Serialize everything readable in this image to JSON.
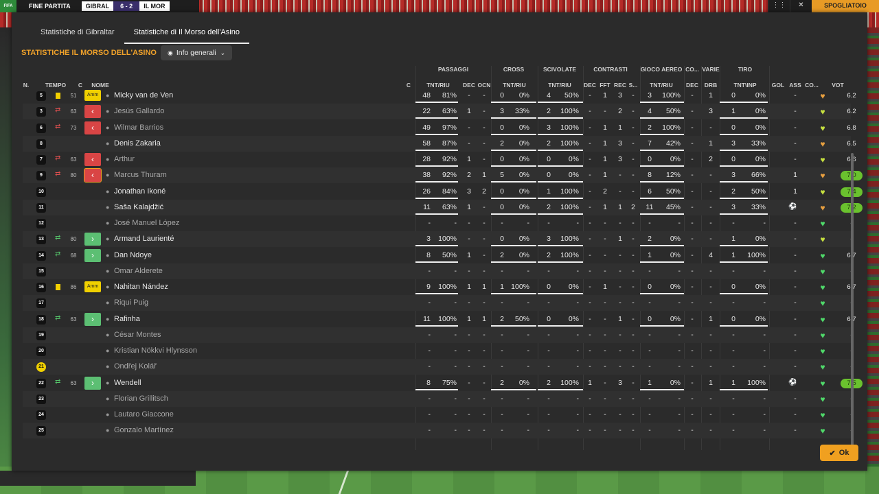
{
  "topbar": {
    "fp": "FINE PARTITA",
    "team1": "GIBRAL",
    "score": "6 - 2",
    "team2": "IL MOR",
    "skip": "SPOGLIATOIO",
    "ctrl1": "⋮⋮",
    "ctrl2": "✕",
    "logo": "FIFA"
  },
  "tabs": [
    {
      "label": "Statistiche di Gibraltar",
      "active": false
    },
    {
      "label": "Statistiche di Il Morso dell'Asino",
      "active": true
    }
  ],
  "title": "STATISTICHE IL MORSO DELL'ASINO",
  "dropdown": {
    "label": "Info generali"
  },
  "groups": {
    "passaggi": "PASSAGGI",
    "cross": "CROSS",
    "scivolate": "SCIVOLATE",
    "contrasti": "CONTRASTI",
    "aereo": "GIOCO AEREO",
    "co": "CO...",
    "varie": "VARIE",
    "tiro": "TIRO"
  },
  "cols": {
    "n": "N.",
    "tempo": "TEMPO",
    "c": "C",
    "nome": "NOME",
    "c2": "C",
    "tntriu1": "TNT/RIU",
    "dec1": "DEC",
    "ocn": "OCN",
    "tntriu2": "TNT/RIU",
    "tntriu3": "TNT/RIU",
    "dec2": "DEC",
    "fft": "FFT",
    "rec": "REC",
    "s": "S...",
    "tntriu4": "TNT/RIU",
    "dec3": "DEC",
    "drb": "DRB",
    "tntinp": "TNT\\INP",
    "gol": "GOL",
    "ass": "ASS",
    "co2": "CO...",
    "vot": "VOT"
  },
  "players": [
    {
      "n": "5",
      "card": "yellow",
      "min": "51",
      "badge": "Amm",
      "name": "Micky van de Ven",
      "dim": false,
      "pt": "48",
      "pr": "81%",
      "pd": "-",
      "po": "-",
      "ct": "0",
      "cr": "0%",
      "st": "4",
      "sr": "50%",
      "td": "-",
      "tf": "1",
      "trc": "3",
      "ts": "-",
      "at": "3",
      "ar": "100%",
      "cd": "-",
      "dr": "1",
      "tt": "0",
      "tr": "0%",
      "gol": "",
      "ass": "-",
      "heart": "orange",
      "vot": "6.2",
      "hi": false
    },
    {
      "n": "3",
      "card": "out",
      "min": "63",
      "badge": "out",
      "name": "Jesús Gallardo",
      "dim": true,
      "pt": "22",
      "pr": "63%",
      "pd": "1",
      "po": "-",
      "ct": "3",
      "cr": "33%",
      "st": "2",
      "sr": "100%",
      "td": "-",
      "tf": "-",
      "trc": "2",
      "ts": "-",
      "at": "4",
      "ar": "50%",
      "cd": "-",
      "dr": "3",
      "tt": "1",
      "tr": "0%",
      "gol": "",
      "ass": "-",
      "heart": "yellowgreen",
      "vot": "6.2",
      "hi": false
    },
    {
      "n": "6",
      "card": "out",
      "min": "73",
      "badge": "out",
      "name": "Wilmar Barrios",
      "dim": true,
      "pt": "49",
      "pr": "97%",
      "pd": "-",
      "po": "-",
      "ct": "0",
      "cr": "0%",
      "st": "3",
      "sr": "100%",
      "td": "-",
      "tf": "1",
      "trc": "1",
      "ts": "-",
      "at": "2",
      "ar": "100%",
      "cd": "-",
      "dr": "-",
      "tt": "0",
      "tr": "0%",
      "gol": "",
      "ass": "-",
      "heart": "yellowgreen",
      "vot": "6.8",
      "hi": false
    },
    {
      "n": "8",
      "card": "",
      "min": "",
      "badge": "",
      "name": "Denis Zakaria",
      "dim": false,
      "pt": "58",
      "pr": "87%",
      "pd": "-",
      "po": "-",
      "ct": "2",
      "cr": "0%",
      "st": "2",
      "sr": "100%",
      "td": "-",
      "tf": "1",
      "trc": "3",
      "ts": "-",
      "at": "7",
      "ar": "42%",
      "cd": "-",
      "dr": "1",
      "tt": "3",
      "tr": "33%",
      "gol": "",
      "ass": "-",
      "heart": "orange",
      "vot": "6.5",
      "hi": false
    },
    {
      "n": "7",
      "card": "out",
      "min": "63",
      "badge": "out",
      "name": "Arthur",
      "dim": true,
      "pt": "28",
      "pr": "92%",
      "pd": "1",
      "po": "-",
      "ct": "0",
      "cr": "0%",
      "st": "0",
      "sr": "0%",
      "td": "-",
      "tf": "1",
      "trc": "3",
      "ts": "-",
      "at": "0",
      "ar": "0%",
      "cd": "-",
      "dr": "2",
      "tt": "0",
      "tr": "0%",
      "gol": "",
      "ass": "-",
      "heart": "yellowgreen",
      "vot": "6.6",
      "hi": false
    },
    {
      "n": "9",
      "card": "out",
      "min": "80",
      "badge": "outsel",
      "name": "Marcus Thuram",
      "dim": true,
      "pt": "38",
      "pr": "92%",
      "pd": "2",
      "po": "1",
      "ct": "5",
      "cr": "0%",
      "st": "0",
      "sr": "0%",
      "td": "-",
      "tf": "1",
      "trc": "-",
      "ts": "-",
      "at": "8",
      "ar": "12%",
      "cd": "-",
      "dr": "-",
      "tt": "3",
      "tr": "66%",
      "gol": "",
      "ass": "1",
      "heart": "orange",
      "vot": "7.0",
      "hi": true
    },
    {
      "n": "10",
      "card": "",
      "min": "",
      "badge": "",
      "name": "Jonathan Ikoné",
      "dim": false,
      "pt": "26",
      "pr": "84%",
      "pd": "3",
      "po": "2",
      "ct": "0",
      "cr": "0%",
      "st": "1",
      "sr": "100%",
      "td": "-",
      "tf": "2",
      "trc": "-",
      "ts": "-",
      "at": "6",
      "ar": "50%",
      "cd": "-",
      "dr": "-",
      "tt": "2",
      "tr": "50%",
      "gol": "",
      "ass": "1",
      "heart": "yellowgreen",
      "vot": "7.4",
      "hi": true
    },
    {
      "n": "11",
      "card": "",
      "min": "",
      "badge": "",
      "name": "Saša Kalajdžić",
      "dim": false,
      "pt": "11",
      "pr": "63%",
      "pd": "1",
      "po": "-",
      "ct": "0",
      "cr": "0%",
      "st": "2",
      "sr": "100%",
      "td": "-",
      "tf": "1",
      "trc": "1",
      "ts": "2",
      "at": "11",
      "ar": "45%",
      "cd": "-",
      "dr": "-",
      "tt": "3",
      "tr": "33%",
      "gol": "ball",
      "ass": "-",
      "heart": "orange",
      "vot": "7.2",
      "hi": true
    },
    {
      "n": "12",
      "card": "",
      "min": "",
      "badge": "",
      "name": "José Manuel López",
      "dim": true,
      "pt": "-",
      "pr": "-",
      "pd": "-",
      "po": "-",
      "ct": "-",
      "cr": "-",
      "st": "-",
      "sr": "-",
      "td": "-",
      "tf": "-",
      "trc": "-",
      "ts": "-",
      "at": "-",
      "ar": "-",
      "cd": "-",
      "dr": "-",
      "tt": "-",
      "tr": "-",
      "gol": "",
      "ass": "-",
      "heart": "green",
      "vot": "-",
      "hi": false
    },
    {
      "n": "13",
      "card": "in",
      "min": "80",
      "badge": "in",
      "name": "Armand Laurienté",
      "dim": false,
      "pt": "3",
      "pr": "100%",
      "pd": "-",
      "po": "-",
      "ct": "0",
      "cr": "0%",
      "st": "3",
      "sr": "100%",
      "td": "-",
      "tf": "-",
      "trc": "1",
      "ts": "-",
      "at": "2",
      "ar": "0%",
      "cd": "-",
      "dr": "-",
      "tt": "1",
      "tr": "0%",
      "gol": "",
      "ass": "-",
      "heart": "yellowgreen",
      "vot": "-",
      "hi": false
    },
    {
      "n": "14",
      "card": "in",
      "min": "68",
      "badge": "in",
      "name": "Dan Ndoye",
      "dim": false,
      "pt": "8",
      "pr": "50%",
      "pd": "1",
      "po": "-",
      "ct": "2",
      "cr": "0%",
      "st": "2",
      "sr": "100%",
      "td": "-",
      "tf": "-",
      "trc": "-",
      "ts": "-",
      "at": "1",
      "ar": "0%",
      "cd": "-",
      "dr": "4",
      "tt": "1",
      "tr": "100%",
      "gol": "",
      "ass": "-",
      "heart": "green",
      "vot": "6.7",
      "hi": false
    },
    {
      "n": "15",
      "card": "",
      "min": "",
      "badge": "",
      "name": "Omar Alderete",
      "dim": true,
      "pt": "-",
      "pr": "-",
      "pd": "-",
      "po": "-",
      "ct": "-",
      "cr": "-",
      "st": "-",
      "sr": "-",
      "td": "-",
      "tf": "-",
      "trc": "-",
      "ts": "-",
      "at": "-",
      "ar": "-",
      "cd": "-",
      "dr": "-",
      "tt": "-",
      "tr": "-",
      "gol": "",
      "ass": "-",
      "heart": "green",
      "vot": "-",
      "hi": false
    },
    {
      "n": "16",
      "card": "yellow",
      "min": "86",
      "badge": "Amm",
      "name": "Nahitan Nández",
      "dim": false,
      "pt": "9",
      "pr": "100%",
      "pd": "1",
      "po": "1",
      "ct": "1",
      "cr": "100%",
      "st": "0",
      "sr": "0%",
      "td": "-",
      "tf": "1",
      "trc": "-",
      "ts": "-",
      "at": "0",
      "ar": "0%",
      "cd": "-",
      "dr": "-",
      "tt": "0",
      "tr": "0%",
      "gol": "",
      "ass": "-",
      "heart": "green",
      "vot": "6.7",
      "hi": false
    },
    {
      "n": "17",
      "card": "",
      "min": "",
      "badge": "",
      "name": "Riqui Puig",
      "dim": true,
      "pt": "-",
      "pr": "-",
      "pd": "-",
      "po": "-",
      "ct": "-",
      "cr": "-",
      "st": "-",
      "sr": "-",
      "td": "-",
      "tf": "-",
      "trc": "-",
      "ts": "-",
      "at": "-",
      "ar": "-",
      "cd": "-",
      "dr": "-",
      "tt": "-",
      "tr": "-",
      "gol": "",
      "ass": "-",
      "heart": "green",
      "vot": "-",
      "hi": false
    },
    {
      "n": "18",
      "card": "in",
      "min": "63",
      "badge": "in",
      "name": "Rafinha",
      "dim": false,
      "pt": "11",
      "pr": "100%",
      "pd": "1",
      "po": "1",
      "ct": "2",
      "cr": "50%",
      "st": "0",
      "sr": "0%",
      "td": "-",
      "tf": "-",
      "trc": "1",
      "ts": "-",
      "at": "0",
      "ar": "0%",
      "cd": "-",
      "dr": "1",
      "tt": "0",
      "tr": "0%",
      "gol": "",
      "ass": "-",
      "heart": "green",
      "vot": "6.7",
      "hi": false
    },
    {
      "n": "19",
      "card": "",
      "min": "",
      "badge": "",
      "name": "César Montes",
      "dim": true,
      "pt": "-",
      "pr": "-",
      "pd": "-",
      "po": "-",
      "ct": "-",
      "cr": "-",
      "st": "-",
      "sr": "-",
      "td": "-",
      "tf": "-",
      "trc": "-",
      "ts": "-",
      "at": "-",
      "ar": "-",
      "cd": "-",
      "dr": "-",
      "tt": "-",
      "tr": "-",
      "gol": "",
      "ass": "-",
      "heart": "green",
      "vot": "-",
      "hi": false
    },
    {
      "n": "20",
      "card": "",
      "min": "",
      "badge": "",
      "name": "Kristian Nökkvi Hlynsson",
      "dim": true,
      "pt": "-",
      "pr": "-",
      "pd": "-",
      "po": "-",
      "ct": "-",
      "cr": "-",
      "st": "-",
      "sr": "-",
      "td": "-",
      "tf": "-",
      "trc": "-",
      "ts": "-",
      "at": "-",
      "ar": "-",
      "cd": "-",
      "dr": "-",
      "tt": "-",
      "tr": "-",
      "gol": "",
      "ass": "-",
      "heart": "green",
      "vot": "-",
      "hi": false
    },
    {
      "n": "21",
      "card": "",
      "min": "",
      "badge": "gk",
      "name": "Ondřej Kolář",
      "dim": true,
      "pt": "-",
      "pr": "-",
      "pd": "-",
      "po": "-",
      "ct": "-",
      "cr": "-",
      "st": "-",
      "sr": "-",
      "td": "-",
      "tf": "-",
      "trc": "-",
      "ts": "-",
      "at": "-",
      "ar": "-",
      "cd": "-",
      "dr": "-",
      "tt": "-",
      "tr": "-",
      "gol": "",
      "ass": "-",
      "heart": "green",
      "vot": "-",
      "hi": false
    },
    {
      "n": "22",
      "card": "in",
      "min": "63",
      "badge": "in",
      "name": "Wendell",
      "dim": false,
      "pt": "8",
      "pr": "75%",
      "pd": "-",
      "po": "-",
      "ct": "2",
      "cr": "0%",
      "st": "2",
      "sr": "100%",
      "td": "1",
      "tf": "-",
      "trc": "3",
      "ts": "-",
      "at": "1",
      "ar": "0%",
      "cd": "-",
      "dr": "1",
      "tt": "1",
      "tr": "100%",
      "gol": "ball",
      "ass": "-",
      "heart": "green",
      "vot": "7.5",
      "hi": true
    },
    {
      "n": "23",
      "card": "",
      "min": "",
      "badge": "",
      "name": "Florian Grillitsch",
      "dim": true,
      "pt": "-",
      "pr": "-",
      "pd": "-",
      "po": "-",
      "ct": "-",
      "cr": "-",
      "st": "-",
      "sr": "-",
      "td": "-",
      "tf": "-",
      "trc": "-",
      "ts": "-",
      "at": "-",
      "ar": "-",
      "cd": "-",
      "dr": "-",
      "tt": "-",
      "tr": "-",
      "gol": "",
      "ass": "-",
      "heart": "green",
      "vot": "-",
      "hi": false
    },
    {
      "n": "24",
      "card": "",
      "min": "",
      "badge": "",
      "name": "Lautaro Giaccone",
      "dim": true,
      "pt": "-",
      "pr": "-",
      "pd": "-",
      "po": "-",
      "ct": "-",
      "cr": "-",
      "st": "-",
      "sr": "-",
      "td": "-",
      "tf": "-",
      "trc": "-",
      "ts": "-",
      "at": "-",
      "ar": "-",
      "cd": "-",
      "dr": "-",
      "tt": "-",
      "tr": "-",
      "gol": "",
      "ass": "-",
      "heart": "green",
      "vot": "-",
      "hi": false
    },
    {
      "n": "25",
      "card": "",
      "min": "",
      "badge": "",
      "name": "Gonzalo Martínez",
      "dim": true,
      "pt": "-",
      "pr": "-",
      "pd": "-",
      "po": "-",
      "ct": "-",
      "cr": "-",
      "st": "-",
      "sr": "-",
      "td": "-",
      "tf": "-",
      "trc": "-",
      "ts": "-",
      "at": "-",
      "ar": "-",
      "cd": "-",
      "dr": "-",
      "tt": "-",
      "tr": "-",
      "gol": "",
      "ass": "-",
      "heart": "green",
      "vot": "-",
      "hi": false
    }
  ],
  "ok": {
    "label": "Ok"
  },
  "colors": {
    "accent": "#f2a32a",
    "orange": "#e8a040",
    "yellowgreen": "#c6e040",
    "green": "#4fd96a"
  }
}
